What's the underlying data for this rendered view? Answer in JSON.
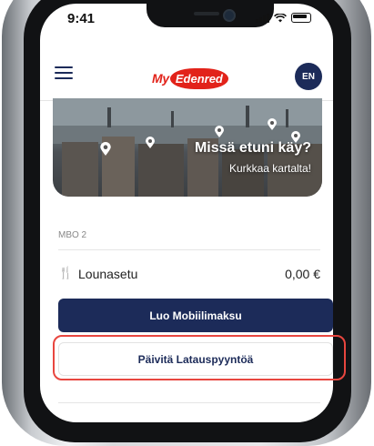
{
  "status_bar": {
    "time": "9:41"
  },
  "header": {
    "logo_my": "My",
    "logo_edenred": "Edenred",
    "language": "EN"
  },
  "banner": {
    "title": "Missä etuni käy?",
    "subtitle": "Kurkkaa kartalta!"
  },
  "account": {
    "label": "MBO 2"
  },
  "benefit": {
    "name": "Lounasetu",
    "amount": "0,00 €"
  },
  "actions": {
    "primary": "Luo Mobiilimaksu",
    "secondary": "Päivitä Latauspyyntöä"
  },
  "colors": {
    "navy": "#1c2b59",
    "brand_red": "#e2231a",
    "highlight": "#e8463f"
  },
  "icons": [
    "hamburger-menu-icon",
    "cutlery-icon",
    "map-pin-icon"
  ]
}
